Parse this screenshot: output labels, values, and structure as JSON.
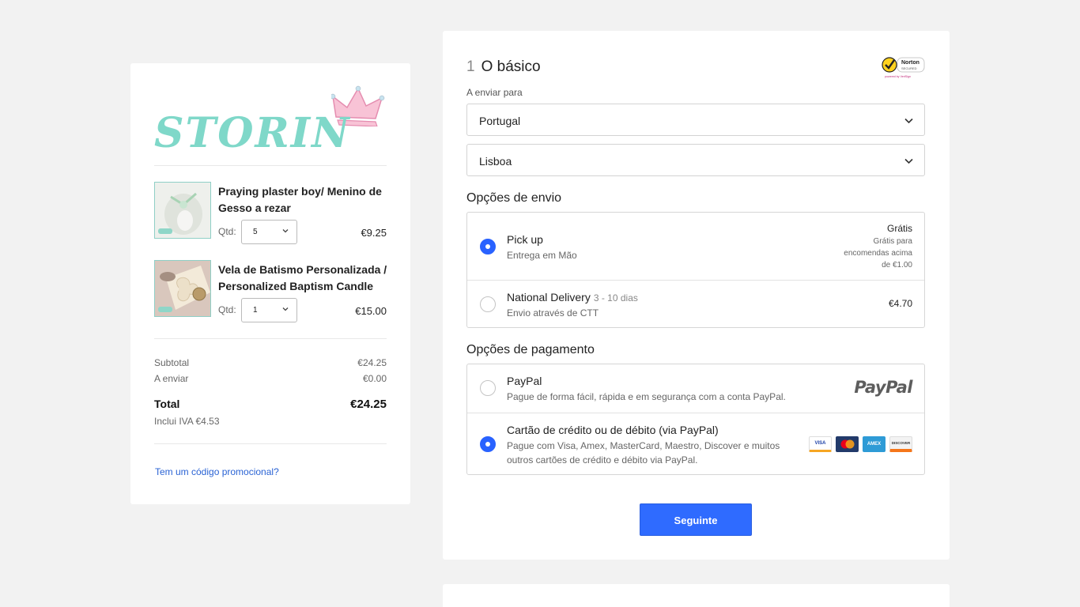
{
  "brand": {
    "logo_text": "STORIN"
  },
  "cart": {
    "items": [
      {
        "name": "Praying plaster boy/ Menino de Gesso a rezar",
        "qty_label": "Qtd:",
        "qty": "5",
        "price": "€9.25"
      },
      {
        "name": "Vela de Batismo Personalizada / Personalized Baptism Candle",
        "qty_label": "Qtd:",
        "qty": "1",
        "price": "€15.00"
      }
    ],
    "subtotal_label": "Subtotal",
    "subtotal": "€24.25",
    "shipping_label": "A enviar",
    "shipping": "€0.00",
    "total_label": "Total",
    "total": "€24.25",
    "tax_note": "Inclui IVA €4.53",
    "promo_link": "Tem um código promocional?"
  },
  "checkout": {
    "step_number": "1",
    "step_title": "O básico",
    "norton_text": "Norton",
    "norton_sub": "SECURED",
    "norton_powered": "powered by VeriSign",
    "ship_to_label": "A enviar para",
    "country": "Portugal",
    "region": "Lisboa",
    "shipping_heading": "Opções de envio",
    "shipping_options": [
      {
        "title": "Pick up",
        "subtitle": "",
        "desc": "Entrega em Mão",
        "price": "Grátis",
        "note": "Grátis para encomendas acima de €1.00",
        "selected": true
      },
      {
        "title": "National Delivery",
        "subtitle": "3 - 10 dias",
        "desc": "Envio através de CTT",
        "price": "€4.70",
        "note": "",
        "selected": false
      }
    ],
    "payment_heading": "Opções de pagamento",
    "payment_options": [
      {
        "title": "PayPal",
        "desc": "Pague de forma fácil, rápida e em segurança com a conta PayPal.",
        "logo": "PayPal",
        "selected": false
      },
      {
        "title": "Cartão de crédito ou de débito (via PayPal)",
        "desc": "Pague com Visa, Amex, MasterCard, Maestro, Discover e muitos outros cartões de crédito e débito via PayPal.",
        "selected": true
      }
    ],
    "card_labels": {
      "visa": "VISA",
      "amex": "AMEX",
      "discover": "DISCOVER"
    },
    "next_button": "Seguinte"
  },
  "colors": {
    "accent": "#2f6bff",
    "logo": "#7fd8c9",
    "crown": "#f4a7c4"
  }
}
